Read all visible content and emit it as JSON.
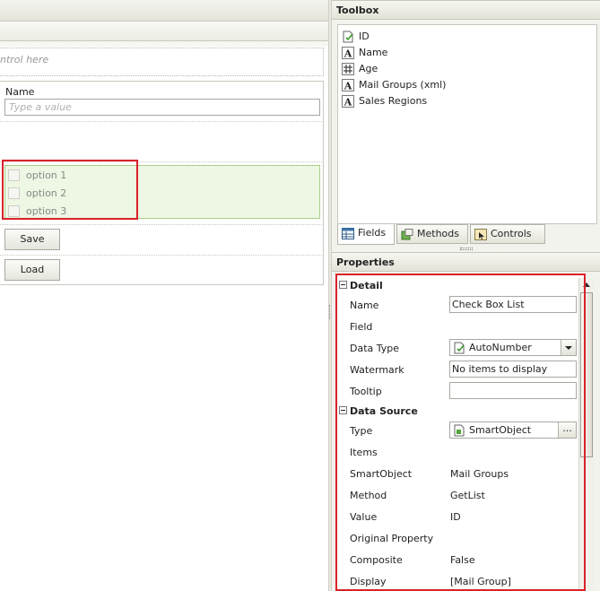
{
  "designer": {
    "dropzone_text": "ntrol here",
    "name_label": "Name",
    "name_placeholder": "Type a value",
    "checkbox_options": [
      "option 1",
      "option 2",
      "option 3"
    ],
    "save_label": "Save",
    "load_label": "Load"
  },
  "toolbox": {
    "title": "Toolbox",
    "items": [
      {
        "label": "ID",
        "icon": "autonumber-icon"
      },
      {
        "label": "Name",
        "icon": "text-field-icon"
      },
      {
        "label": "Age",
        "icon": "number-field-icon"
      },
      {
        "label": "Mail Groups (xml)",
        "icon": "text-field-icon"
      },
      {
        "label": "Sales Regions",
        "icon": "text-field-icon"
      }
    ],
    "tabs": [
      {
        "label": "Fields",
        "icon": "fields-icon",
        "active": true
      },
      {
        "label": "Methods",
        "icon": "methods-icon",
        "active": false
      },
      {
        "label": "Controls",
        "icon": "controls-icon",
        "active": false
      }
    ]
  },
  "properties": {
    "title": "Properties",
    "detail_section": "Detail",
    "detail": {
      "name_label": "Name",
      "name_value": "Check Box List",
      "field_label": "Field",
      "datatype_label": "Data Type",
      "datatype_value": "AutoNumber",
      "watermark_label": "Watermark",
      "watermark_value": "No items to display",
      "tooltip_label": "Tooltip",
      "tooltip_value": ""
    },
    "datasource_section": "Data Source",
    "datasource": {
      "type_label": "Type",
      "type_value": "SmartObject",
      "type_button": "...",
      "items_label": "Items",
      "smartobject_label": "SmartObject",
      "smartobject_value": "Mail Groups",
      "method_label": "Method",
      "method_value": "GetList",
      "value_label": "Value",
      "value_value": "ID",
      "origprop_label": "Original Property",
      "origprop_value": "",
      "composite_label": "Composite",
      "composite_value": "False",
      "display_label": "Display",
      "display_value": "[Mail Group]"
    }
  },
  "colors": {
    "highlight": "#d9232a",
    "checkbox_list_bg": "#eef7e3",
    "checkbox_list_border": "#a9cf86"
  }
}
